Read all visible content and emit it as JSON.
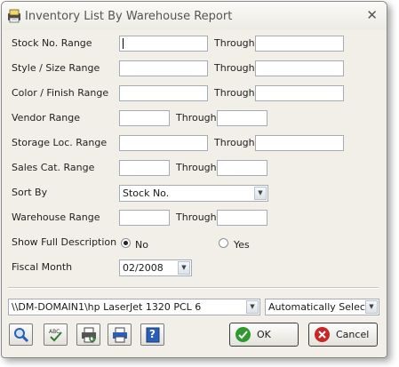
{
  "window": {
    "title": "Inventory List By Warehouse Report"
  },
  "form": {
    "rows": [
      {
        "label": "Stock No. Range",
        "through": "Through",
        "from": "",
        "to": ""
      },
      {
        "label": "Style / Size Range",
        "through": "Through",
        "from": "",
        "to": ""
      },
      {
        "label": "Color / Finish Range",
        "through": "Through",
        "from": "",
        "to": ""
      },
      {
        "label": "Vendor Range",
        "through": "Through",
        "from": "",
        "to": ""
      },
      {
        "label": "Storage Loc. Range",
        "through": "Through",
        "from": "",
        "to": ""
      },
      {
        "label": "Sales Cat. Range",
        "through": "Through",
        "from": "",
        "to": ""
      },
      {
        "label": "Sort By",
        "value": "Stock No."
      },
      {
        "label": "Warehouse Range",
        "through": "Through",
        "from": "",
        "to": ""
      },
      {
        "label": "Show Full Description",
        "option_no": "No",
        "option_yes": "Yes",
        "selected": "No"
      },
      {
        "label": "Fiscal Month",
        "value": "02/2008"
      }
    ]
  },
  "printer": {
    "name": "\\\\DM-DOMAIN1\\hp LaserJet 1320 PCL 6",
    "mode": "Automatically Select"
  },
  "toolbar": {
    "icons": [
      "magnifier-icon",
      "spell-check-icon",
      "print-preview-icon",
      "printer-icon",
      "help-icon"
    ],
    "help_glyph": "?"
  },
  "buttons": {
    "ok": "OK",
    "cancel": "Cancel"
  },
  "colors": {
    "ok_green": "#2e9a2e",
    "cancel_red": "#c62828",
    "accent_blue": "#2a5fb8"
  }
}
